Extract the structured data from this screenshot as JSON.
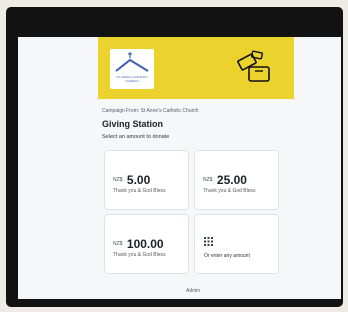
{
  "header": {
    "logo_text": "ST ANNE'S CATHOLIC CHURCH",
    "org_line": "Campaign From: St Anne's Catholic Church",
    "title": "Giving Station",
    "instruction": "Select an amount to donate"
  },
  "options": [
    {
      "currency": "NZ$",
      "amount": "5.00",
      "message": "Thank you & God Bless"
    },
    {
      "currency": "NZ$",
      "amount": "25.00",
      "message": "Thank you & God Bless"
    },
    {
      "currency": "NZ$",
      "amount": "100.00",
      "message": "Thank you & God Bless"
    }
  ],
  "other": {
    "label": "Or enter any amount",
    "icon": "keypad-icon"
  },
  "footer": {
    "admin_label": "Admin"
  },
  "icons": {
    "logo": "church-logo",
    "banner": "donation-box-icon"
  },
  "colors": {
    "banner": "#ecd22c",
    "logo_blue": "#3f5fb0",
    "frame": "#121212",
    "screen": "#f6f7f9"
  }
}
